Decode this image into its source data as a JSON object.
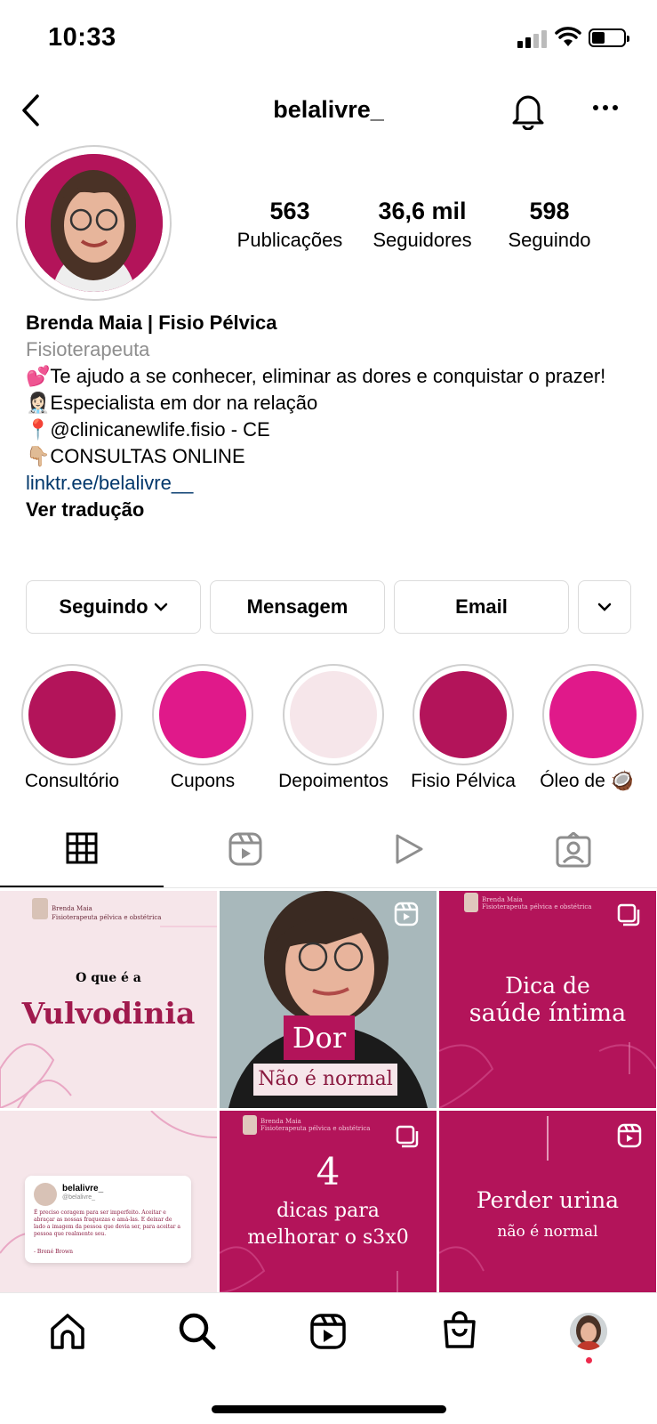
{
  "status": {
    "time": "10:33"
  },
  "header": {
    "username": "belalivre_"
  },
  "stats": [
    {
      "value": "563",
      "label": "Publicações"
    },
    {
      "value": "36,6 mil",
      "label": "Seguidores"
    },
    {
      "value": "598",
      "label": "Seguindo"
    }
  ],
  "bio": {
    "name": "Brenda Maia | Fisio Pélvica",
    "category": "Fisioterapeuta",
    "line1": "💕Te ajudo a se conhecer, eliminar as dores e conquistar o prazer!",
    "line2": "👩🏻‍⚕️Especialista em dor na relação",
    "line3": "📍@clinicanewlife.fisio - CE",
    "line4": "👇🏼CONSULTAS ONLINE",
    "link": "linktr.ee/belalivre__",
    "translate": "Ver tradução"
  },
  "buttons": {
    "following": "Seguindo",
    "message": "Mensagem",
    "email": "Email"
  },
  "highlights": [
    {
      "label": "Consultório",
      "color": "#b3145a"
    },
    {
      "label": "Cupons",
      "color": "#e0198a"
    },
    {
      "label": "Depoimentos",
      "color": "#f6e6ea"
    },
    {
      "label": "Fisio Pélvica",
      "color": "#b3145a"
    },
    {
      "label": "Óleo de 🥥",
      "color": "#e0198a"
    }
  ],
  "posts": {
    "p1": {
      "author": "Brenda Maia",
      "subtitle": "Fisioterapeuta pélvica e obstétrica",
      "line1": "O que é a",
      "line2": "Vulvodinia"
    },
    "p2": {
      "line1": "Dor",
      "line2": "Não é normal"
    },
    "p3": {
      "author": "Brenda Maia",
      "subtitle": "Fisioterapeuta pélvica e obstétrica",
      "line1": "Dica de",
      "line2": "saúde íntima"
    },
    "p4": {
      "user": "belalivre_",
      "handle": "@belalivre_",
      "quote": "É preciso coragem para ser imperfeito. Aceitar e abraçar as nossas fraquezas e amá-las. E deixar de lado a imagem da pessoa que devia ser, para aceitar a pessoa que realmente sou.",
      "cite": "- Brené Brown"
    },
    "p5": {
      "author": "Brenda Maia",
      "subtitle": "Fisioterapeuta pélvica e obstétrica",
      "num": "4",
      "line1": "dicas para",
      "line2": "melhorar o s3x0"
    },
    "p6": {
      "line1": "Perder urina",
      "line2": "não é normal"
    }
  },
  "colors": {
    "magenta": "#b3145a",
    "pink": "#e0198a",
    "link": "#00376b"
  }
}
